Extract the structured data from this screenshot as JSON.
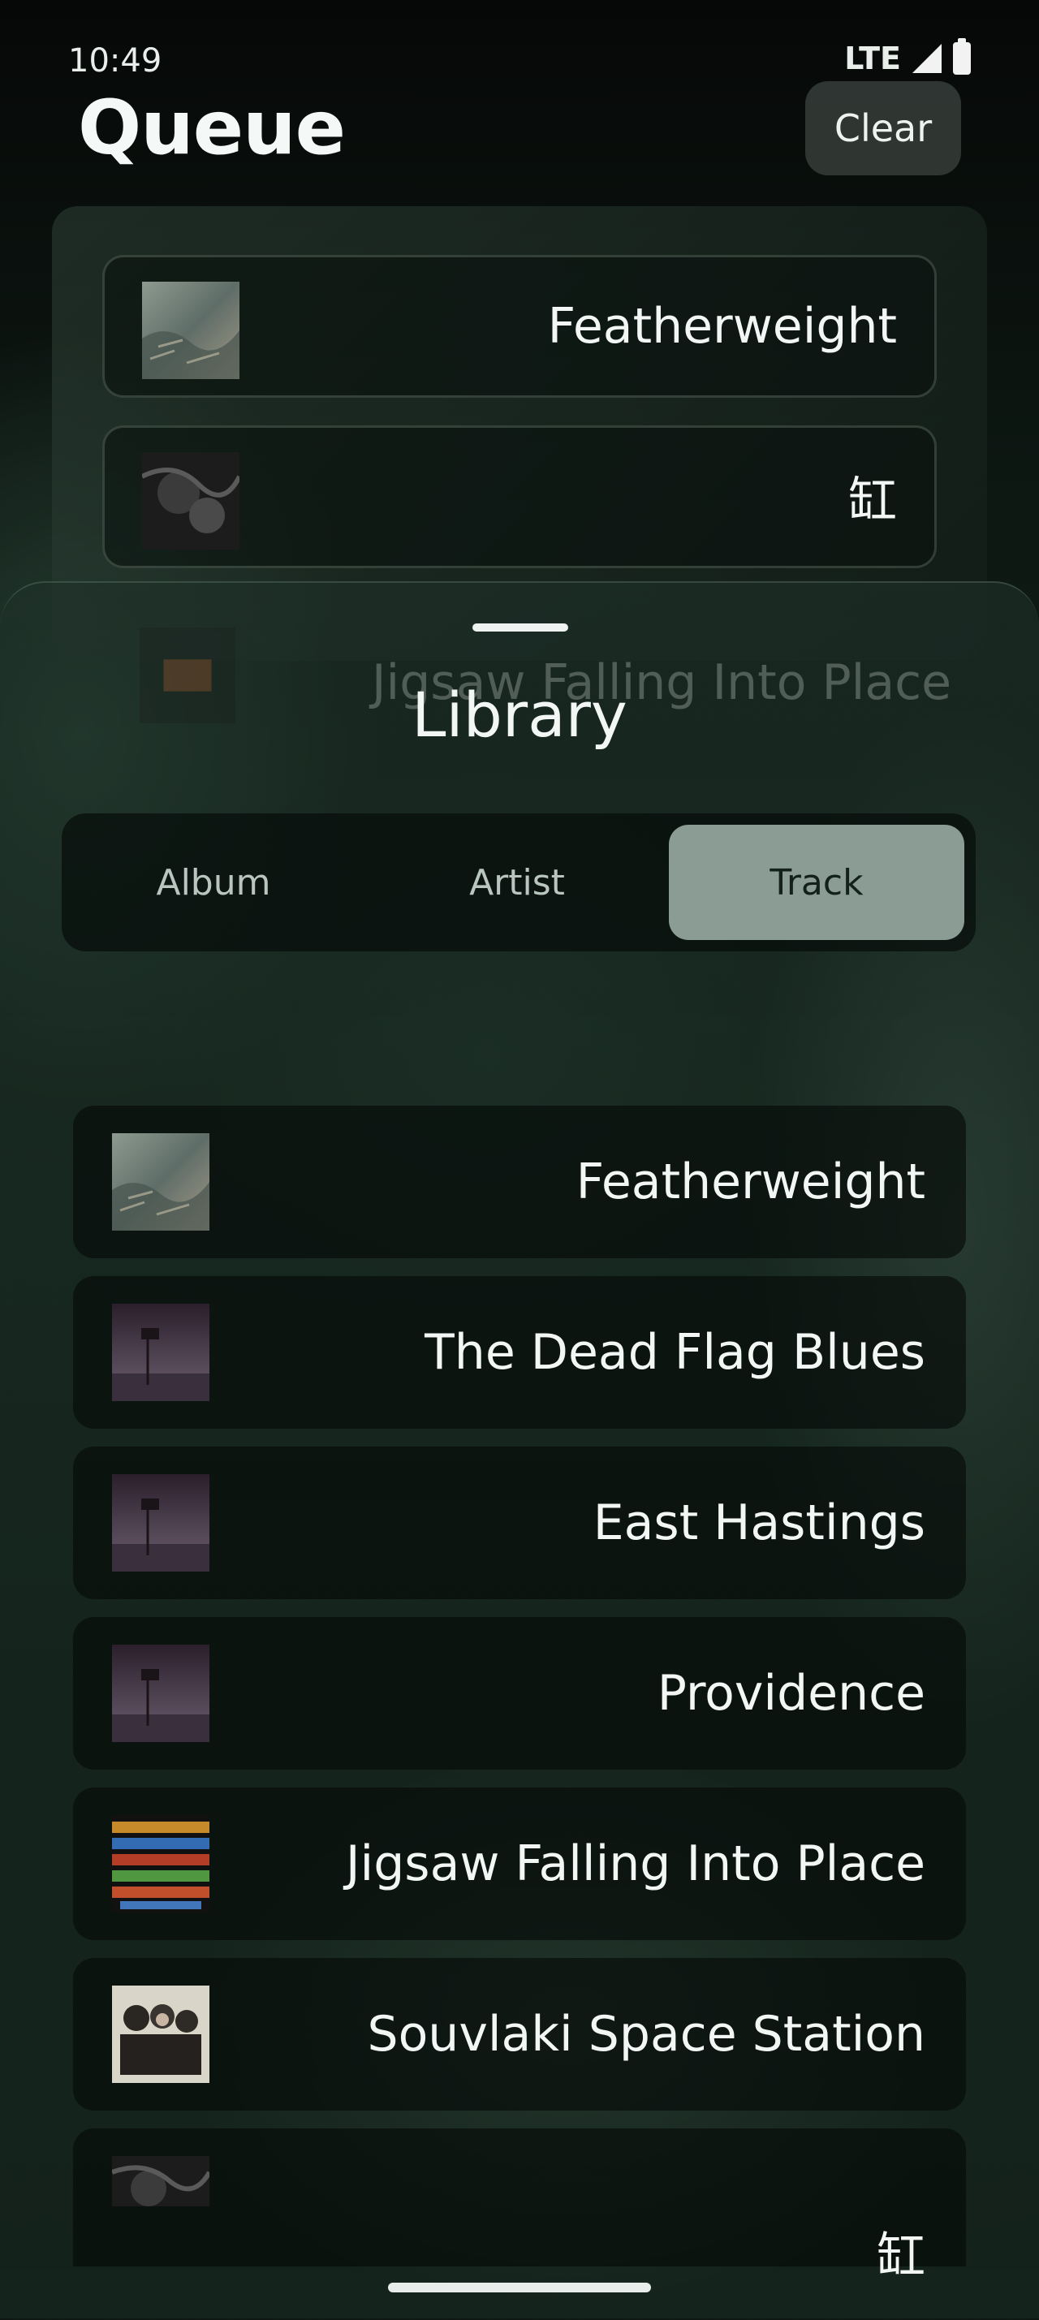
{
  "status_bar": {
    "time": "10:49",
    "network": "LTE"
  },
  "header": {
    "title": "Queue",
    "clear_label": "Clear"
  },
  "queue": {
    "items": [
      {
        "title": "Featherweight",
        "art": "featherweight-art"
      },
      {
        "title": "缸",
        "art": "hong-art"
      }
    ]
  },
  "library": {
    "title": "Library",
    "ghost_item": {
      "title": "Jigsaw Falling Into Place"
    },
    "tabs": [
      {
        "label": "Album",
        "selected": false
      },
      {
        "label": "Artist",
        "selected": false
      },
      {
        "label": "Track",
        "selected": true
      }
    ],
    "tracks": [
      {
        "title": "Featherweight",
        "art": "featherweight-art"
      },
      {
        "title": "The Dead Flag Blues",
        "art": "dead-flag-art"
      },
      {
        "title": "East Hastings",
        "art": "dead-flag-art"
      },
      {
        "title": "Providence",
        "art": "dead-flag-art"
      },
      {
        "title": "Jigsaw Falling Into Place",
        "art": "in-rainbows-art"
      },
      {
        "title": "Souvlaki Space Station",
        "art": "souvlaki-art"
      },
      {
        "title": "缸",
        "art": "hong-art"
      }
    ]
  }
}
